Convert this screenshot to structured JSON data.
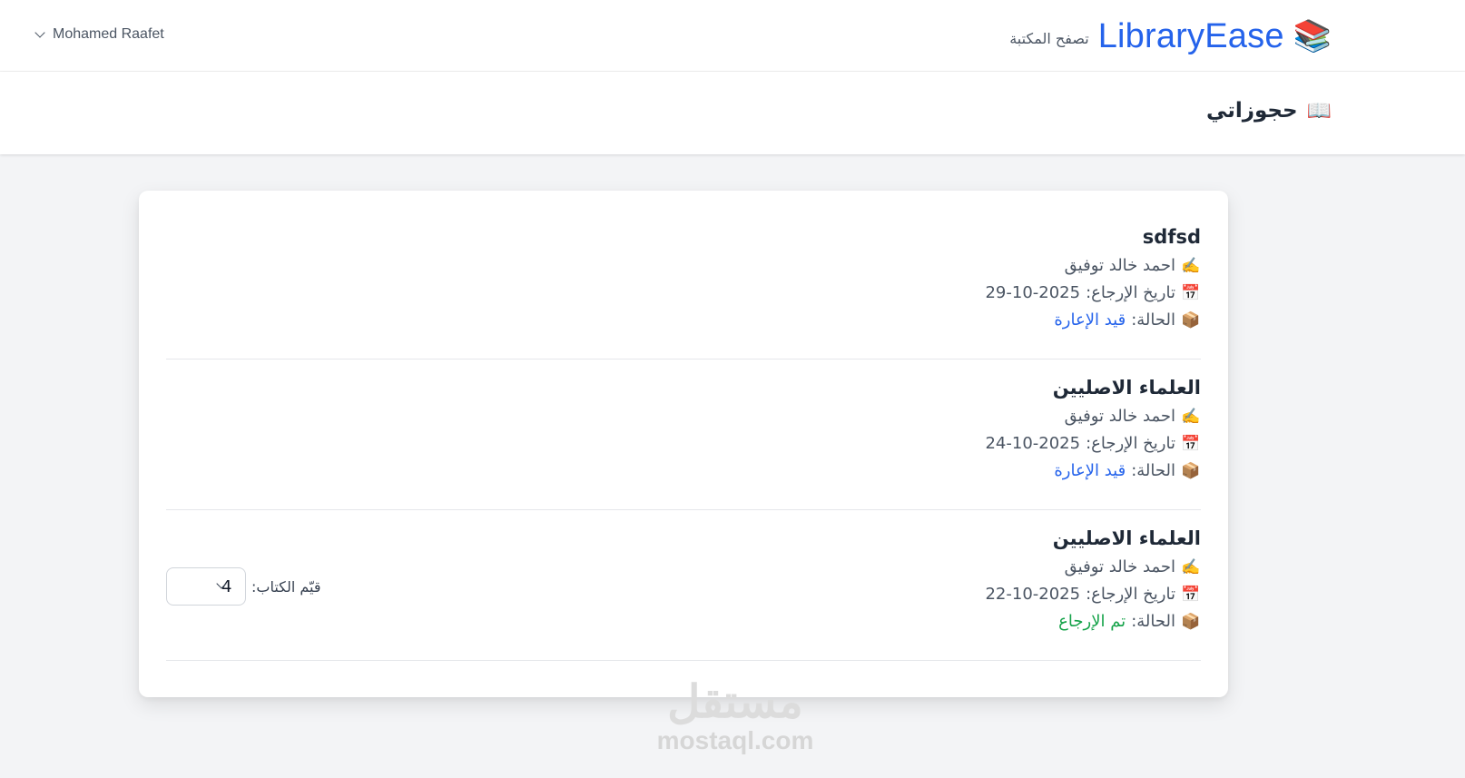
{
  "nav": {
    "brand_icon": "📚",
    "brand_name": "LibraryEase",
    "browse_link": "تصفح المكتبة",
    "user_name": "Mohamed Raafet",
    "user_chevron": "chevron-down-icon"
  },
  "page": {
    "title_icon": "📖",
    "title": "حجوزاتي"
  },
  "reservations": [
    {
      "title": "sdfsd",
      "author_icon": "✍️",
      "author": "احمد خالد توفيق",
      "date_icon": "📅",
      "return_label": "تاريخ الإرجاع:",
      "return_date": "29-10-2025",
      "status_icon": "📦",
      "status_label": "الحالة:",
      "status": "قيد الإعارة",
      "status_color": "#2563eb"
    },
    {
      "title": "العلماء الاصليين",
      "author_icon": "✍️",
      "author": "احمد خالد توفيق",
      "date_icon": "📅",
      "return_label": "تاريخ الإرجاع:",
      "return_date": "24-10-2025",
      "status_icon": "📦",
      "status_label": "الحالة:",
      "status": "قيد الإعارة",
      "status_color": "#2563eb"
    },
    {
      "title": "العلماء الاصليين",
      "author_icon": "✍️",
      "author": "احمد خالد توفيق",
      "date_icon": "📅",
      "return_label": "تاريخ الإرجاع:",
      "return_date": "22-10-2025",
      "status_icon": "📦",
      "status_label": "الحالة:",
      "status": "تم الإرجاع",
      "status_color": "#16a34a",
      "rating_label": "قيّم الكتاب:",
      "rating_value": "4"
    }
  ],
  "watermark": {
    "arabic": "مستقل",
    "latin": "mostaql.com"
  }
}
